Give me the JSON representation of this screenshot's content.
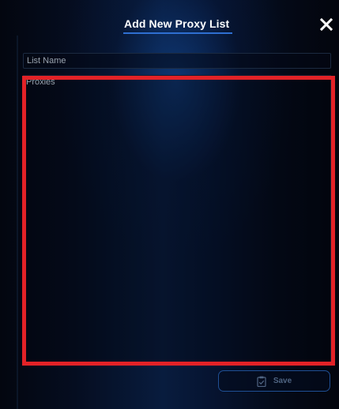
{
  "dialog": {
    "title": "Add New Proxy List",
    "close_icon": "close-icon"
  },
  "form": {
    "list_name": {
      "placeholder": "List Name",
      "value": ""
    },
    "proxies": {
      "placeholder": "Proxies",
      "value": ""
    }
  },
  "footer": {
    "save_label": "Save",
    "save_icon": "clipboard-check-icon"
  },
  "colors": {
    "highlight": "#e32227",
    "accent": "#2e6fd1",
    "background": "#03050d"
  }
}
